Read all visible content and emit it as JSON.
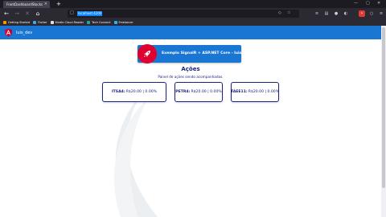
{
  "browser": {
    "tab": {
      "title": "FrontDashboardStocks",
      "close": "×"
    },
    "new_tab": "+",
    "window_controls": {
      "minimize": "—",
      "maximize": "▢",
      "close": "✕"
    },
    "url": "localhost:4200",
    "bookmarks": [
      {
        "label": "Getting Started",
        "color": "#ff9400"
      },
      {
        "label": "Flutter",
        "color": "#42a5f5"
      },
      {
        "label": "Kindle Cloud Reader",
        "color": "#e0e0e0"
      },
      {
        "label": "Tech Connect",
        "color": "#26a69a"
      },
      {
        "label": "Freelancer",
        "color": "#29b2fe"
      }
    ]
  },
  "app": {
    "toolbar_title": "luis_dev",
    "brand_color": "#1976d2",
    "accent_color": "#dd0031",
    "cta_label": "Exemplo SignalR + ASP.NET Core - luis_dev",
    "section_title": "Ações",
    "section_subtitle": "Painel de ações sendo acompanhadas.",
    "stocks": [
      {
        "ticker": "ITSA4:",
        "value": "R$20.00 | 0.00%"
      },
      {
        "ticker": "PETR4:",
        "value": "R$20.00 | 0.00%"
      },
      {
        "ticker": "TAEE11:",
        "value": "R$20.00 | 0.00%"
      }
    ]
  }
}
